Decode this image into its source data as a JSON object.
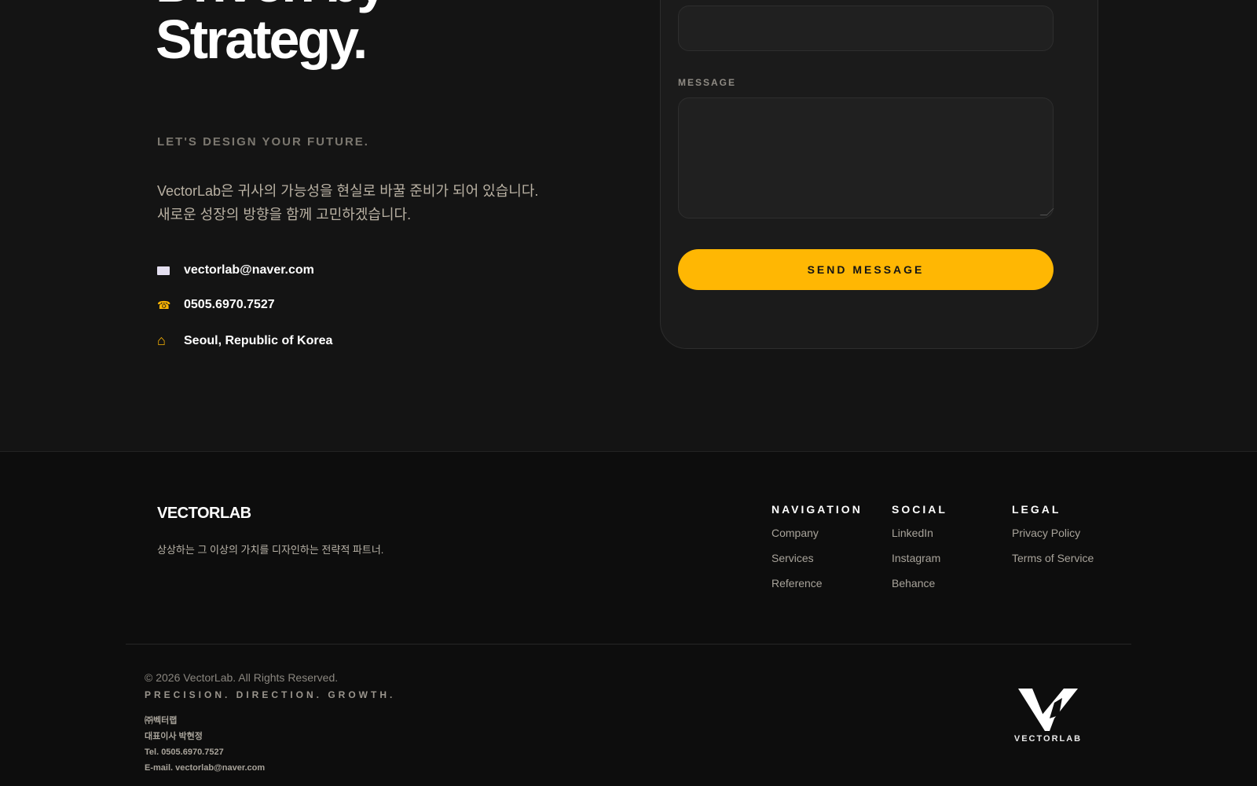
{
  "hero": {
    "headline_lines": [
      "Driven by",
      "Strategy."
    ],
    "kicker": "LET'S DESIGN YOUR FUTURE.",
    "intro_lines": [
      "VectorLab은 귀사의 가능성을 현실로 바꿀 준비가 되어 있습니다.",
      "새로운 성장의 방향을 함께 고민하겠습니다."
    ],
    "contacts": {
      "email": {
        "icon": "envelope-icon",
        "text": "vectorlab@naver.com"
      },
      "phone": {
        "icon": "telephone-icon",
        "glyph": "☎",
        "text": "0505.6970.7527"
      },
      "address": {
        "icon": "home-icon",
        "glyph": "⌂",
        "text": "Seoul, Republic of Korea"
      }
    }
  },
  "contact_form": {
    "top_field_value": "",
    "message_label": "MESSAGE",
    "message_value": "",
    "send_label": "SEND MESSAGE"
  },
  "footer": {
    "brand": "VECTORLAB",
    "tagline": "상상하는 그 이상의 가치를 디자인하는 전략적 파트너.",
    "columns": [
      {
        "heading": "NAVIGATION",
        "links": [
          "Company",
          "Services",
          "Reference"
        ]
      },
      {
        "heading": "SOCIAL",
        "links": [
          "LinkedIn",
          "Instagram",
          "Behance"
        ]
      },
      {
        "heading": "LEGAL",
        "links": [
          "Privacy Policy",
          "Terms of Service"
        ]
      }
    ],
    "copyright": "© 2026 VectorLab. All Rights Reserved.",
    "motto": "PRECISION. DIRECTION. GROWTH.",
    "company_lines": [
      "㈜벡터랩",
      "대표이사 박현정",
      "Tel. 0505.6970.7527",
      "E-mail. vectorlab@naver.com"
    ],
    "logo_text": "VECTORLAB"
  },
  "colors": {
    "accent": "#ffb703",
    "background_top": "#141414",
    "background_footer": "#0d0d0d",
    "card": "#1b1b1b"
  }
}
